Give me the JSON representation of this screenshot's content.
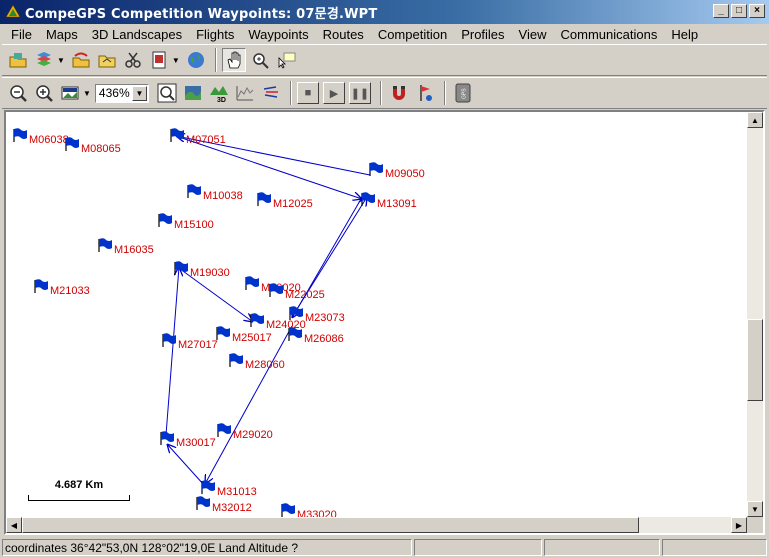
{
  "window": {
    "title": "CompeGPS Competition Waypoints:  07문경.WPT",
    "minimize": "_",
    "maximize": "□",
    "close": "×"
  },
  "menu": [
    "File",
    "Maps",
    "3D Landscapes",
    "Flights",
    "Waypoints",
    "Routes",
    "Competition",
    "Profiles",
    "View",
    "Communications",
    "Help"
  ],
  "toolbar2": {
    "zoom_value": "436%"
  },
  "map": {
    "route_color": "#0000cc",
    "flag_color": "#0033cc",
    "label_color": "#d00000",
    "waypoints": [
      {
        "name": "M06038"
      },
      {
        "name": "M08065"
      },
      {
        "name": "M07051"
      },
      {
        "name": "M09050"
      },
      {
        "name": "M10038"
      },
      {
        "name": "M12025"
      },
      {
        "name": "M13091"
      },
      {
        "name": "M15100"
      },
      {
        "name": "M16035"
      },
      {
        "name": "M19030"
      },
      {
        "name": "M20020"
      },
      {
        "name": "M22025"
      },
      {
        "name": "M21033"
      },
      {
        "name": "M23073"
      },
      {
        "name": "M24020"
      },
      {
        "name": "M25017"
      },
      {
        "name": "M26086"
      },
      {
        "name": "M27017"
      },
      {
        "name": "M28060"
      },
      {
        "name": "M29020"
      },
      {
        "name": "M30017"
      },
      {
        "name": "M31013"
      },
      {
        "name": "M32012"
      },
      {
        "name": "M33020"
      }
    ],
    "scale_label": "4.687 Km"
  },
  "status": {
    "coordinates": "coordinates 36°42\"53,0N 128°02\"19,0E Land Altitude ?"
  }
}
